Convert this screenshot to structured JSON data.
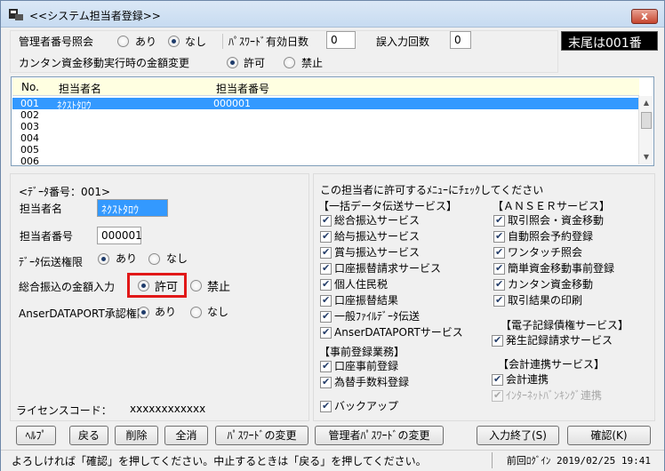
{
  "window": {
    "title": "<<システム担当者登録>>",
    "close_label": "x"
  },
  "settings": {
    "manager_number_inquiry": "管理者番号照会",
    "option_yes": "あり",
    "option_no": "なし",
    "password_expiration_days_label": "ﾊﾟｽﾜｰﾄﾞ有効日数",
    "password_expiration_days_value": "0",
    "input_error_count_label": "誤入力回数",
    "input_error_count_value": "0",
    "suffix_badge": "末尾は001番",
    "amount_change_label": "カンタン資金移動実行時の金額変更",
    "permit": "許可",
    "prohibit": "禁止"
  },
  "list": {
    "columns": [
      "No.",
      "担当者名",
      "担当者番号"
    ],
    "rows": [
      {
        "no": "001",
        "name": "ﾈｸｽﾄﾀﾛｳ",
        "number": "000001",
        "selected": true
      },
      {
        "no": "002",
        "name": "",
        "number": ""
      },
      {
        "no": "003",
        "name": "",
        "number": ""
      },
      {
        "no": "004",
        "name": "",
        "number": ""
      },
      {
        "no": "005",
        "name": "",
        "number": ""
      },
      {
        "no": "006",
        "name": "",
        "number": ""
      }
    ]
  },
  "detail": {
    "data_number": "<ﾃﾞｰﾀ番号：001>",
    "person_name_label": "担当者名",
    "person_name_value": "ﾈｸｽﾄﾀﾛｳ",
    "person_number_label": "担当者番号",
    "person_number_value": "000001",
    "data_transfer_auth_label": "ﾃﾞｰﾀ伝送権限",
    "transfer_amount_input_label": "総合振込の金額入力",
    "anser_auth_label": "AnserDATAPORT承認権限",
    "license_code_label": "ライセンスコード：",
    "license_code_value": "xxxxxxxxxxxx"
  },
  "menu_permissions": {
    "heading": "この担当者に許可するﾒﾆｭｰにﾁｪｯｸしてください",
    "batch_service_heading": "【一括データ伝送サービス】",
    "batch_items": [
      "総合振込サービス",
      "給与振込サービス",
      "賞与振込サービス",
      "口座振替請求サービス",
      "個人住民税",
      "口座振替結果",
      "一般ﾌｧｲﾙﾃﾞｰﾀ伝送",
      "AnserDATAPORTサービス"
    ],
    "anser_heading": "【ＡＮＳＥＲサービス】",
    "anser_items": [
      "取引照会・資金移動",
      "自動照会予約登録",
      "ワンタッチ照会",
      "簡単資金移動事前登録",
      "カンタン資金移動",
      "取引結果の印刷"
    ],
    "electronic_heading": "【電子記録債権サービス】",
    "electronic_items": [
      "発生記録請求サービス"
    ],
    "pre_registration_heading": "【事前登録業務】",
    "pre_registration_items": [
      "口座事前登録",
      "為替手数料登録"
    ],
    "accounting_heading": "【会計連携サービス】",
    "accounting_items": [
      "会計連携",
      "ｲﾝﾀｰﾈｯﾄﾊﾞﾝｷﾝｸﾞ連携"
    ],
    "backup_label": "バックアップ"
  },
  "buttons": {
    "help": "ﾍﾙﾌﾟ",
    "back": "戻る",
    "delete": "削除",
    "clear": "全消",
    "change_password": "ﾊﾟｽﾜｰﾄﾞの変更",
    "change_manager_password": "管理者ﾊﾟｽﾜｰﾄﾞの変更",
    "finish_input": "入力終了(S)",
    "confirm": "確認(K)"
  },
  "status": {
    "message": "よろしければ「確認」を押してください。中止するときは「戻る」を押してください。",
    "last_login": "前回ﾛｸﾞｲﾝ 2019/02/25 19:41"
  },
  "colors": {
    "selection": "#3399ff",
    "highlight": "#e11818",
    "header_bg": "#ffffe1"
  }
}
